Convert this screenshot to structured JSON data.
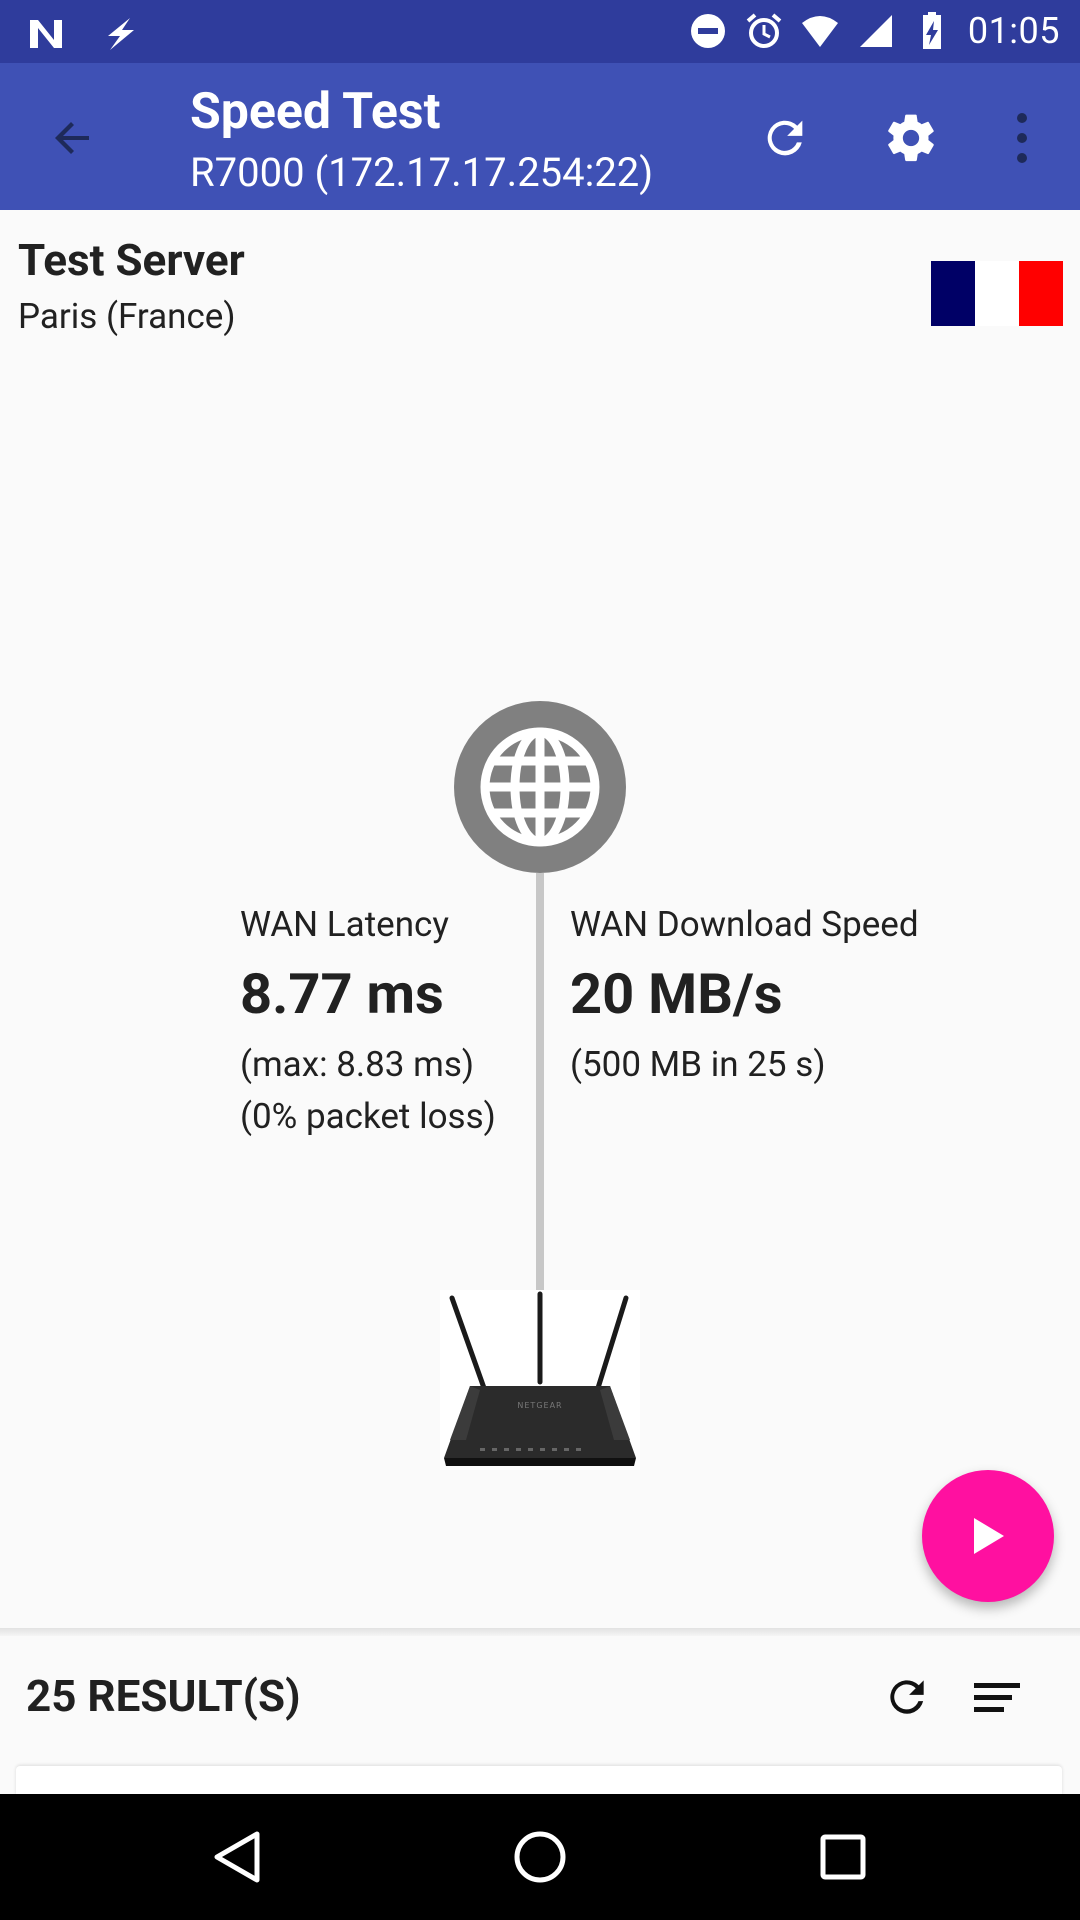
{
  "status_bar": {
    "time": "01:05",
    "left_icons": [
      "n-notification-icon",
      "flash-icon"
    ],
    "right_icons": [
      "dnd-icon",
      "alarm-icon",
      "wifi-icon",
      "signal-icon",
      "battery-charging-icon"
    ]
  },
  "app_bar": {
    "title": "Speed Test",
    "subtitle": "R7000 (172.17.17.254:22)",
    "color": "#3f51b5"
  },
  "server": {
    "title": "Test Server",
    "location": "Paris (France)",
    "flag_colors": [
      "#000066",
      "#ffffff",
      "#ff0000"
    ]
  },
  "latency": {
    "label": "WAN Latency",
    "value": "8.77 ms",
    "max": "(max: 8.83 ms)",
    "loss": "(0% packet loss)"
  },
  "download": {
    "label": "WAN Download Speed",
    "value": "20 MB/s",
    "detail": "(500 MB in 25 s)"
  },
  "router": {
    "brand": "NETGEAR"
  },
  "fab": {
    "color": "#ff10a0"
  },
  "results": {
    "count_label": "25 RESULT(S)"
  }
}
